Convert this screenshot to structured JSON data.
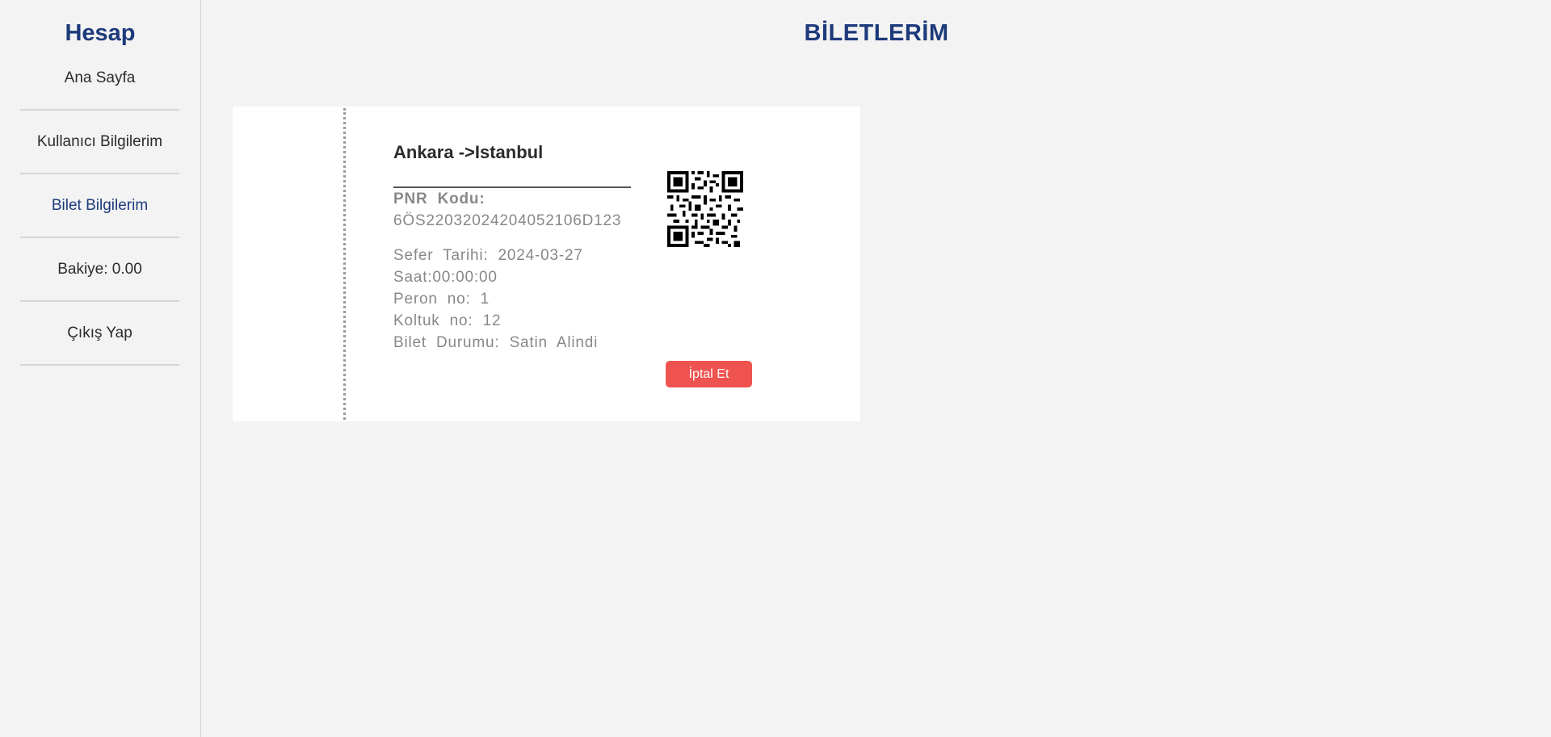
{
  "sidebar": {
    "title": "Hesap",
    "items": [
      {
        "label": "Ana Sayfa"
      },
      {
        "label": "Kullanıcı Bilgilerim"
      },
      {
        "label": "Bilet Bilgilerim"
      },
      {
        "label": "Bakiye: 0.00"
      },
      {
        "label": "Çıkış Yap"
      }
    ],
    "active_item": "Bilet Bilgilerim"
  },
  "page": {
    "title": "BİLETLERİM"
  },
  "ticket": {
    "route": "Ankara ->Istanbul",
    "pnr_label": "PNR Kodu:",
    "pnr_value": "6ÖS22032024204052106D123",
    "details": [
      "Sefer Tarihi: 2024-03-27",
      "Saat:00:00:00",
      "Peron no: 1",
      "Koltuk no: 12",
      "Bilet Durumu: Satin Alindi"
    ],
    "qr_icon": "qr-code-icon",
    "cancel_label": "İptal Et"
  },
  "colors": {
    "accent": "#1d3a7b",
    "background": "#f3f3f3",
    "cancel": "#ef5350"
  }
}
